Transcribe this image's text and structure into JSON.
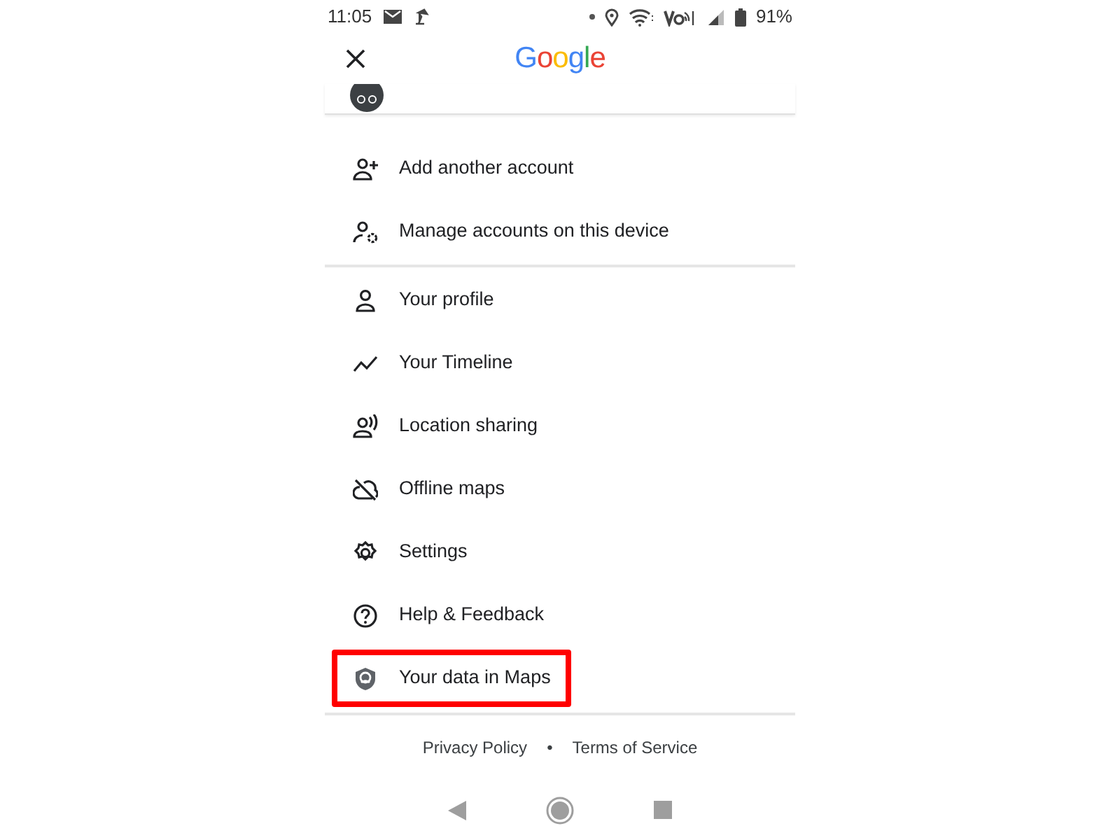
{
  "status_bar": {
    "time": "11:05",
    "battery": "91%"
  },
  "header": {
    "logo": "Google"
  },
  "menu": [
    [
      {
        "label": "Add another account",
        "highlighted": false
      },
      {
        "label": "Manage accounts on this device",
        "highlighted": false
      }
    ],
    [
      {
        "label": "Your profile",
        "highlighted": false
      },
      {
        "label": "Your Timeline",
        "highlighted": false
      },
      {
        "label": "Location sharing",
        "highlighted": false
      },
      {
        "label": "Offline maps",
        "highlighted": false
      },
      {
        "label": "Settings",
        "highlighted": false
      },
      {
        "label": "Help & Feedback",
        "highlighted": false
      },
      {
        "label": "Your data in Maps",
        "highlighted": true
      }
    ]
  ],
  "footer": {
    "links": [
      "Privacy Policy",
      "Terms of Service"
    ],
    "separator": "•"
  }
}
